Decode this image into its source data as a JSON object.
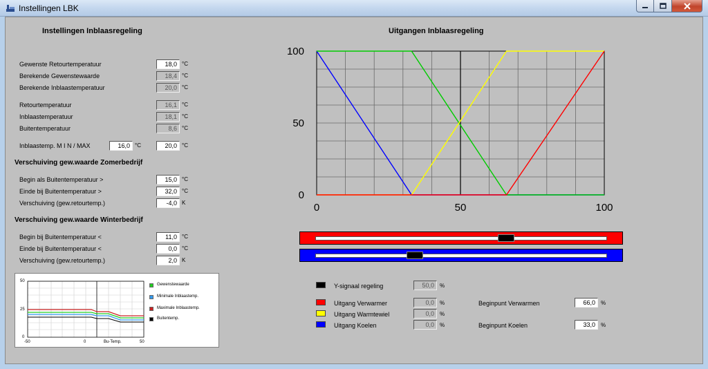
{
  "window": {
    "title": "Instellingen LBK"
  },
  "left": {
    "header": "Instellingen Inblaasregeling",
    "rows": [
      {
        "label": "Gewenste Retourtemperatuur",
        "value": "18,0",
        "unit": "°C",
        "readonly": false
      },
      {
        "label": "Berekende Gewenstewaarde",
        "value": "18,4",
        "unit": "°C",
        "readonly": true
      },
      {
        "label": "Berekende Inblaastemperatuur",
        "value": "20,0",
        "unit": "°C",
        "readonly": true
      },
      {
        "label": "Retourtemperatuur",
        "value": "16,1",
        "unit": "°C",
        "readonly": true
      },
      {
        "label": "Inblaastemperatuur",
        "value": "18,1",
        "unit": "°C",
        "readonly": true
      },
      {
        "label": "Buitentemperatuur",
        "value": "8,6",
        "unit": "°C",
        "readonly": true
      }
    ],
    "minmax": {
      "label": "Inblaastemp.  M I N / MAX",
      "min": "16,0",
      "min_unit": "°C",
      "max": "20,0",
      "max_unit": "°C"
    },
    "summer": {
      "header": "Verschuiving gew.waarde Zomerbedrijf",
      "rows": [
        {
          "label": "Begin als Buitentemperatuur  >",
          "value": "15,0",
          "unit": "°C"
        },
        {
          "label": "Einde bij Buitentemperatuur  >",
          "value": "32,0",
          "unit": "°C"
        },
        {
          "label": "Verschuiving (gew.retourtemp.)",
          "value": "-4,0",
          "unit": "K"
        }
      ]
    },
    "winter": {
      "header": "Verschuiving gew.waarde Winterbedrijf",
      "rows": [
        {
          "label": "Begin bij Buitentemperatuur  <",
          "value": "11,0",
          "unit": "°C"
        },
        {
          "label": "Einde bij Buitentemperatuur  <",
          "value": "0,0",
          "unit": "°C"
        },
        {
          "label": "Verschuiving (gew.retourtemp.)",
          "value": "2,0",
          "unit": "K"
        }
      ]
    },
    "mini_chart": {
      "y_ticks": [
        "50",
        "25",
        "0"
      ],
      "x_ticks": [
        "-50",
        "0",
        "Bu-Temp.",
        "50"
      ],
      "legend": [
        {
          "label": "Gewenstewaarde",
          "color": "#22cc22"
        },
        {
          "label": "Minimale Inblaastemp.",
          "color": "#3399ee"
        },
        {
          "label": "Maximale Inblaastemp.",
          "color": "#cc2222"
        },
        {
          "label": "Buitentemp.",
          "color": "#000000"
        }
      ]
    }
  },
  "right": {
    "chart_title": "Uitgangen Inblaasregeling",
    "chart_data": {
      "type": "line",
      "title": "Uitgangen Inblaasregeling",
      "xlim": [
        0,
        100
      ],
      "ylim": [
        0,
        100
      ],
      "x_ticks": [
        "0",
        "50",
        "100"
      ],
      "y_ticks": [
        "100",
        "50",
        "0"
      ],
      "grid": true,
      "series": [
        {
          "color": "#0000ff",
          "points": [
            [
              0,
              100
            ],
            [
              33,
              0
            ],
            [
              100,
              0
            ]
          ]
        },
        {
          "color": "#00cc00",
          "points": [
            [
              0,
              100
            ],
            [
              33,
              100
            ],
            [
              66,
              0
            ],
            [
              100,
              0
            ]
          ]
        },
        {
          "color": "#ffff00",
          "points": [
            [
              0,
              0
            ],
            [
              33,
              0
            ],
            [
              66,
              100
            ],
            [
              100,
              100
            ]
          ]
        },
        {
          "color": "#ff0000",
          "points": [
            [
              0,
              0
            ],
            [
              66,
              0
            ],
            [
              100,
              100
            ]
          ]
        }
      ]
    },
    "sliders": [
      {
        "color": "#ff0000",
        "value_fraction": 0.66
      },
      {
        "color": "#0000ff",
        "value_fraction": 0.33
      }
    ],
    "outputs": [
      {
        "label": "Y-signaal regeling",
        "value": "50,0",
        "unit": "%",
        "color": "#000000"
      },
      {
        "label": "Uitgang Verwarmer",
        "value": "0,0",
        "unit": "%",
        "color": "#ff0000"
      },
      {
        "label": "Uitgang Warmtewiel",
        "value": "0,0",
        "unit": "%",
        "color": "#ffff00"
      },
      {
        "label": "Uitgang Koelen",
        "value": "0,0",
        "unit": "%",
        "color": "#0000ff"
      }
    ],
    "begin": [
      {
        "label": "Beginpunt Verwarmen",
        "value": "66,0",
        "unit": "%"
      },
      {
        "label": "Beginpunt Koelen",
        "value": "33,0",
        "unit": "%"
      }
    ]
  }
}
